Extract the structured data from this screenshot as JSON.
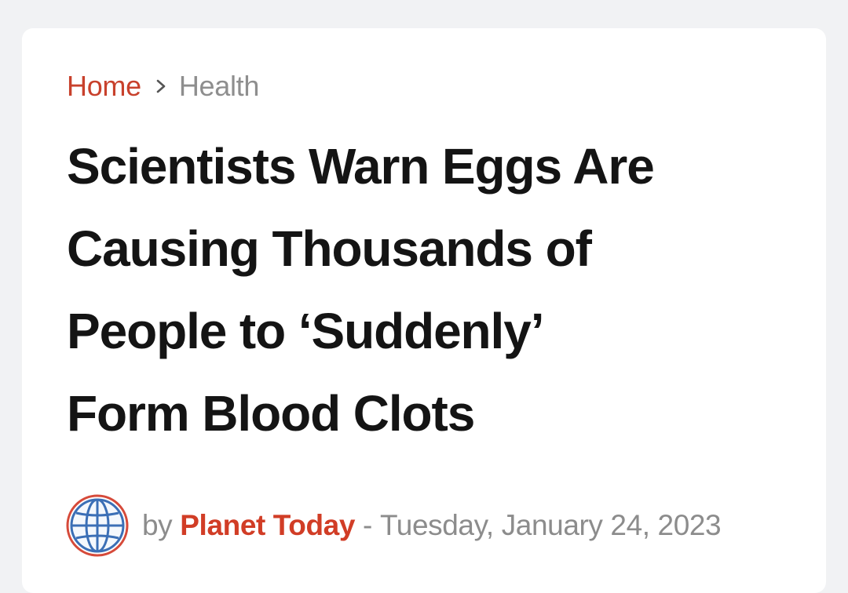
{
  "breadcrumb": {
    "home": "Home",
    "separator_icon": "chevron-right-icon",
    "current": "Health"
  },
  "article": {
    "headline_lines": [
      "Scientists Warn Eggs Are",
      "Causing Thousands of",
      "People to ‘Suddenly’",
      "Form Blood Clots"
    ],
    "byline": {
      "avatar_icon": "globe-icon",
      "by": "by",
      "author": "Planet Today",
      "dash": "-",
      "date": "Tuesday, January 24, 2023"
    }
  },
  "colors": {
    "page_background": "#f1f2f4",
    "card_background": "#ffffff",
    "accent": "#c8412c",
    "headline": "#141414",
    "muted": "#8c8c8c",
    "globe_blue": "#3b6fb6"
  }
}
